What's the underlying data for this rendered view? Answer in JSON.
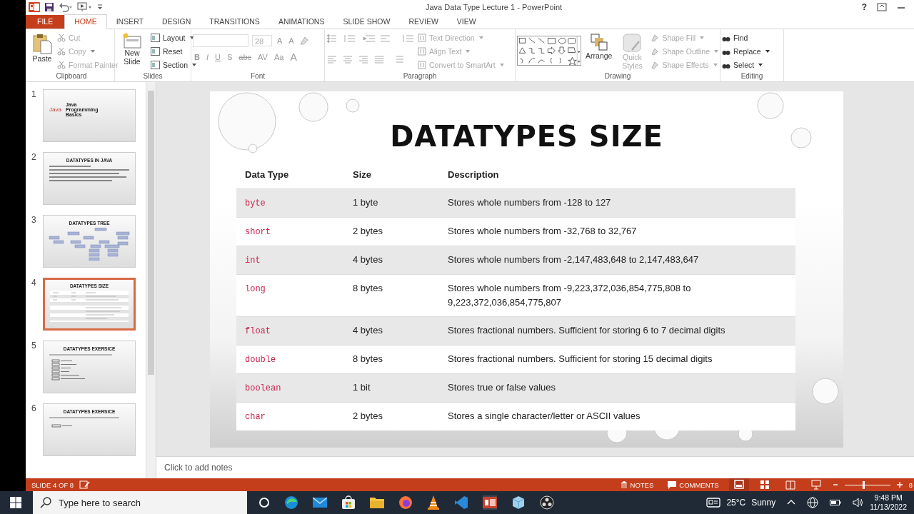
{
  "window": {
    "title": "Java Data Type Lecture 1 - PowerPoint",
    "help": "?"
  },
  "tabs": [
    {
      "label": "FILE",
      "selected": false,
      "kind": "file"
    },
    {
      "label": "HOME",
      "selected": true,
      "kind": "tab"
    },
    {
      "label": "INSERT",
      "selected": false,
      "kind": "tab"
    },
    {
      "label": "DESIGN",
      "selected": false,
      "kind": "tab"
    },
    {
      "label": "TRANSITIONS",
      "selected": false,
      "kind": "tab"
    },
    {
      "label": "ANIMATIONS",
      "selected": false,
      "kind": "tab"
    },
    {
      "label": "SLIDE SHOW",
      "selected": false,
      "kind": "tab"
    },
    {
      "label": "REVIEW",
      "selected": false,
      "kind": "tab"
    },
    {
      "label": "VIEW",
      "selected": false,
      "kind": "tab"
    }
  ],
  "ribbon": {
    "clipboard": {
      "label": "Clipboard",
      "paste": {
        "label": "Paste",
        "disabled": false
      },
      "items": [
        {
          "label": "Cut",
          "disabled": true,
          "dropdown": false
        },
        {
          "label": "Copy",
          "disabled": true,
          "dropdown": true
        },
        {
          "label": "Format Painter",
          "disabled": true,
          "dropdown": false
        }
      ]
    },
    "slides": {
      "label": "Slides",
      "new_slide": {
        "label": "New Slide",
        "disabled": false
      },
      "items": [
        {
          "label": "Layout",
          "disabled": false,
          "dropdown": true
        },
        {
          "label": "Reset",
          "disabled": false,
          "dropdown": false
        },
        {
          "label": "Section",
          "disabled": false,
          "dropdown": true
        }
      ]
    },
    "font": {
      "label": "Font",
      "size": "28",
      "size_buttons": [
        "A",
        "A"
      ],
      "buttons": [
        "B",
        "I",
        "U",
        "S",
        "abc",
        "AV",
        "Aa",
        "A"
      ]
    },
    "paragraph": {
      "label": "Paragraph",
      "items": [
        {
          "label": "Text Direction",
          "disabled": true,
          "dropdown": true
        },
        {
          "label": "Align Text",
          "disabled": true,
          "dropdown": true
        },
        {
          "label": "Convert to SmartArt",
          "disabled": true,
          "dropdown": true
        }
      ]
    },
    "drawing": {
      "label": "Drawing",
      "arrange": {
        "label": "Arrange",
        "disabled": false
      },
      "quick_styles": {
        "label": "Quick Styles",
        "disabled": true
      },
      "items": [
        {
          "label": "Shape Fill",
          "disabled": true,
          "dropdown": true
        },
        {
          "label": "Shape Outline",
          "disabled": true,
          "dropdown": true
        },
        {
          "label": "Shape Effects",
          "disabled": true,
          "dropdown": true
        }
      ]
    },
    "editing": {
      "label": "Editing",
      "items": [
        {
          "label": "Find",
          "disabled": false,
          "dropdown": false
        },
        {
          "label": "Replace",
          "disabled": false,
          "dropdown": true
        },
        {
          "label": "Select",
          "disabled": false,
          "dropdown": true
        }
      ]
    }
  },
  "thumbnails": [
    {
      "number": "1",
      "title": "Java Programming Basics",
      "logo": "Java",
      "kind": "title",
      "selected": false
    },
    {
      "number": "2",
      "title": "DATATYPES IN JAVA",
      "kind": "bullets",
      "selected": false
    },
    {
      "number": "3",
      "title": "DATATYPES TREE",
      "kind": "tree",
      "selected": false
    },
    {
      "number": "4",
      "title": "DATATYPES SIZE",
      "kind": "table",
      "selected": true
    },
    {
      "number": "5",
      "title": "DATATYPES EXERSICE",
      "kind": "exercise",
      "selected": false
    },
    {
      "number": "6",
      "title": "DATATYPES EXERSICE",
      "kind": "exercise2",
      "selected": false
    }
  ],
  "slide": {
    "title": "DATATYPES SIZE",
    "table": {
      "columns": [
        "Data Type",
        "Size",
        "Description"
      ],
      "rows": [
        {
          "type": "byte",
          "size": "1 byte",
          "description": "Stores whole numbers from -128 to 127"
        },
        {
          "type": "short",
          "size": "2 bytes",
          "description": "Stores whole numbers from -32,768 to 32,767"
        },
        {
          "type": "int",
          "size": "4 bytes",
          "description": "Stores whole numbers from -2,147,483,648 to 2,147,483,647"
        },
        {
          "type": "long",
          "size": "8 bytes",
          "description": "Stores whole numbers from -9,223,372,036,854,775,808 to 9,223,372,036,854,775,807"
        },
        {
          "type": "float",
          "size": "4 bytes",
          "description": "Stores fractional numbers. Sufficient for storing 6 to 7 decimal digits"
        },
        {
          "type": "double",
          "size": "8 bytes",
          "description": "Stores fractional numbers. Sufficient for storing 15 decimal digits"
        },
        {
          "type": "boolean",
          "size": "1 bit",
          "description": "Stores true or false values"
        },
        {
          "type": "char",
          "size": "2 bytes",
          "description": "Stores a single character/letter or ASCII values"
        }
      ]
    }
  },
  "notes": {
    "placeholder": "Click to add notes"
  },
  "status_bar": {
    "slide": "SLIDE 4 OF 8",
    "notes": "NOTES",
    "comments": "COMMENTS",
    "zoom": {
      "level": 0.4
    },
    "zoom_percent": "8"
  },
  "taskbar": {
    "search": {
      "placeholder": "Type here to search"
    },
    "temperature": "25°C",
    "weather": "Sunny",
    "time": "9:48 PM",
    "date": "11/13/2022"
  }
}
